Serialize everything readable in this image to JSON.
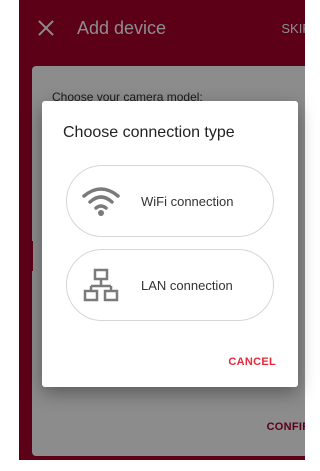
{
  "app_bar": {
    "title": "Add device",
    "skip_label": "SKIP"
  },
  "background_card": {
    "prompt": "Choose your camera model:",
    "confirm_label": "CONFIRM"
  },
  "dialog": {
    "title": "Choose connection type",
    "options": [
      {
        "label": "WiFi connection",
        "icon": "wifi-icon"
      },
      {
        "label": "LAN connection",
        "icon": "lan-icon"
      }
    ],
    "cancel_label": "CANCEL"
  },
  "colors": {
    "brand": "#a8002d",
    "cancel": "#e5283a",
    "icon_gray": "#7a7a7a"
  }
}
